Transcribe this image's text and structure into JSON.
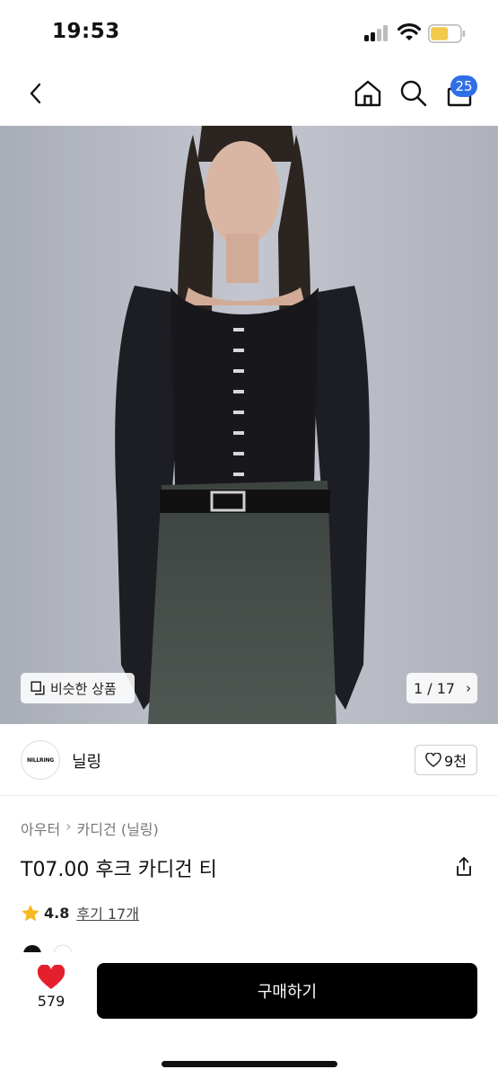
{
  "status_bar": {
    "time": "19:53",
    "battery_color": "#f2c94c"
  },
  "nav": {
    "back_icon": "chevron-left-icon",
    "home_icon": "home-icon",
    "search_icon": "search-icon",
    "cart_icon": "shopping-bag-icon",
    "cart_count": "25"
  },
  "hero": {
    "similar_label": "비슷한 상품",
    "pager": "1 / 17"
  },
  "store": {
    "logo_text": "NILLRING",
    "name": "닐링",
    "like_count": "9천"
  },
  "product": {
    "breadcrumb": [
      "아우터",
      "카디건 (닐링)"
    ],
    "title": "T07.00 후크 카디건 티",
    "rating": "4.8",
    "reviews": "후기 17개"
  },
  "bottom": {
    "heart_count": "579",
    "buy_label": "구매하기",
    "heart_color": "#e5202e"
  }
}
